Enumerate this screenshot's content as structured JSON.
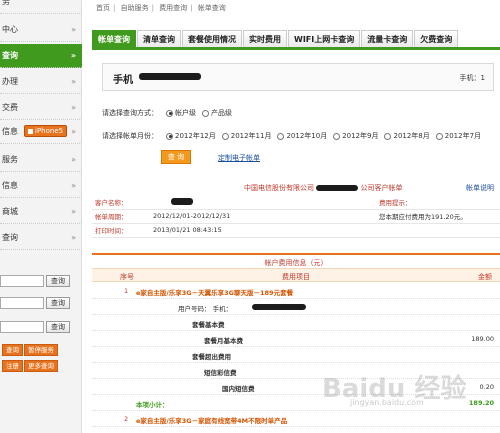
{
  "breadcrumb": [
    "首页",
    "自助服务",
    "费用查询",
    "帐单查询"
  ],
  "sidebar": {
    "items": [
      {
        "label": "务",
        "active": false
      },
      {
        "label": "中心",
        "active": false
      },
      {
        "label": "查询",
        "active": true
      },
      {
        "label": "办理",
        "active": false
      },
      {
        "label": "交费",
        "active": false
      },
      {
        "label": "信息",
        "active": false,
        "badge": "iPhone5"
      },
      {
        "label": "服务",
        "active": false
      },
      {
        "label": "信息",
        "active": false
      },
      {
        "label": "商城",
        "active": false
      },
      {
        "label": "查询",
        "active": false
      }
    ],
    "query_button": "查询",
    "btn_a": "查询",
    "btn_b": "暂停服务",
    "btn_c": "注册",
    "btn_d": "更多查询"
  },
  "tabs": [
    "帐单查询",
    "清单查询",
    "套餐使用情况",
    "实时费用",
    "WIFI上网卡查询",
    "流量卡查询",
    "欠费查询"
  ],
  "phone": {
    "label": "手机",
    "right_label": "手机：1"
  },
  "query": {
    "method_label": "请选择查询方式：",
    "methods": [
      {
        "label": "帐户级",
        "checked": true
      },
      {
        "label": "产品级",
        "checked": false
      }
    ],
    "month_label": "请选择帐单月份：",
    "months": [
      {
        "label": "2012年12月",
        "checked": true
      },
      {
        "label": "2012年11月",
        "checked": false
      },
      {
        "label": "2012年10月",
        "checked": false
      },
      {
        "label": "2012年9月",
        "checked": false
      },
      {
        "label": "2012年8月",
        "checked": false
      },
      {
        "label": "2012年7月",
        "checked": false
      }
    ],
    "button": "查 询",
    "custom_link": "定制电子帐单"
  },
  "bill": {
    "title": "中国电信股份有限公司",
    "title_suffix": "公司客户帐单",
    "link": "帐单说明",
    "rows": [
      {
        "label": "客户名称：",
        "value": "",
        "side_label": "费用提示："
      },
      {
        "label": "帐单周期：",
        "value": "2012/12/01-2012/12/31",
        "side_label": "您本期应付费用为191.20元。"
      },
      {
        "label": "打印时间：",
        "value": "2013/01/21 08:43:15",
        "side_label": ""
      }
    ]
  },
  "fee": {
    "title": "帐户费用信息（元）",
    "headers": [
      "序号",
      "费用项目",
      "金额"
    ],
    "rows": [
      {
        "no": "1",
        "item": "e家自主版/乐享3G－天翼乐享3G聊天版－189元套餐",
        "amount": "",
        "style": "orange",
        "indent": 0
      },
      {
        "no": "",
        "item": "用户号码： 手机：",
        "amount": "",
        "style": "",
        "indent": 1
      },
      {
        "no": "",
        "item": "套餐基本费",
        "amount": "",
        "style": "bold",
        "indent": 2
      },
      {
        "no": "",
        "item": "套餐月基本费",
        "amount": "189.00",
        "style": "bold",
        "indent": 3
      },
      {
        "no": "",
        "item": "套餐超出费用",
        "amount": "",
        "style": "bold",
        "indent": 2
      },
      {
        "no": "",
        "item": "短信彩信费",
        "amount": "",
        "style": "bold",
        "indent": 3
      },
      {
        "no": "",
        "item": "国内短信费",
        "amount": "0.20",
        "style": "bold",
        "indent": 4
      },
      {
        "no": "",
        "item": "本项小计：",
        "amount": "189.20",
        "style": "green",
        "indent": 0
      },
      {
        "no": "2",
        "item": "e家自主版/乐享3G－家庭有线宽带4M不限时单产品",
        "amount": "",
        "style": "orange",
        "indent": 0
      }
    ]
  },
  "watermark": {
    "text": "Baidu 经验",
    "sub": "jingyan.baidu.com"
  }
}
